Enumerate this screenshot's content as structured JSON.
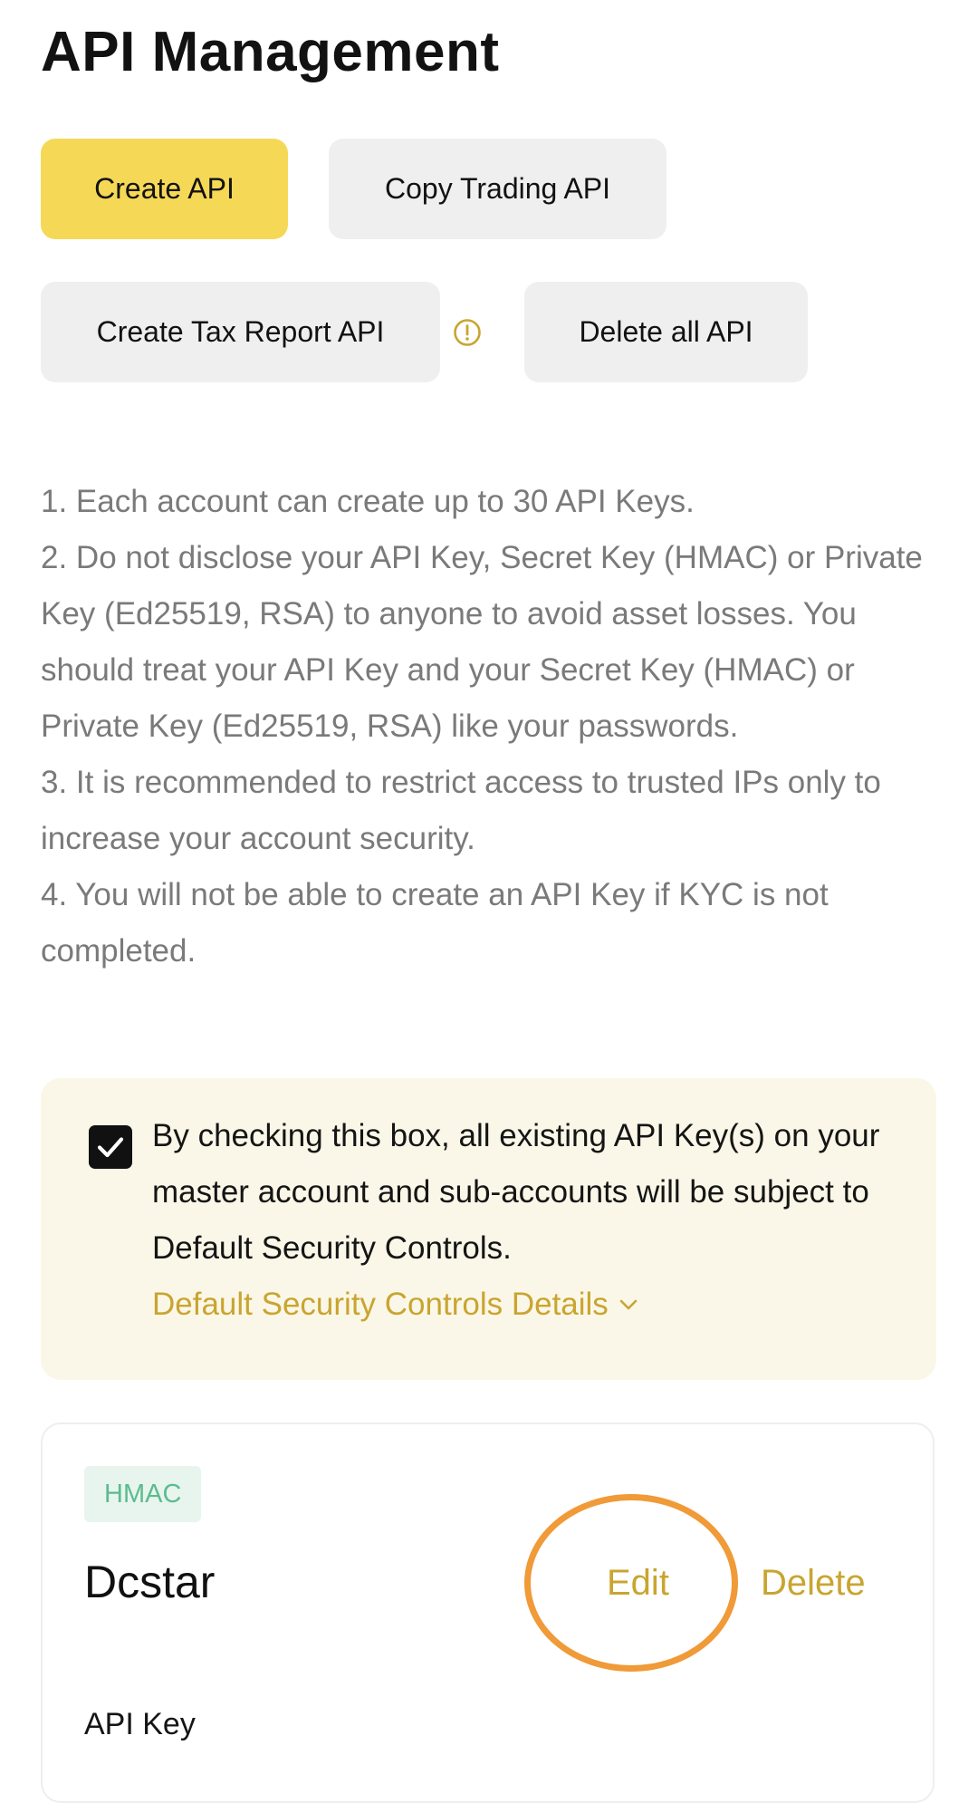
{
  "header": {
    "title": "API Management"
  },
  "actions": {
    "create_api": "Create API",
    "copy_trading_api": "Copy Trading API",
    "create_tax_report_api": "Create Tax Report API",
    "delete_all_api": "Delete all API"
  },
  "notes": [
    "1. Each account can create up to 30 API Keys.",
    "2. Do not disclose your API Key, Secret Key (HMAC) or Private Key (Ed25519, RSA) to anyone to avoid asset losses. You should treat your API Key and your Secret Key (HMAC) or Private Key (Ed25519, RSA) like your passwords.",
    "3. It is recommended to restrict access to trusted IPs only to increase your account security.",
    "4. You will not be able to create an API Key if KYC is not completed."
  ],
  "security_controls": {
    "checked": true,
    "text": "By checking this box, all existing API Key(s) on your master account and sub-accounts will be subject to Default Security Controls.",
    "details_link": "Default Security Controls Details"
  },
  "api_card": {
    "type_badge": "HMAC",
    "name": "Dcstar",
    "edit_label": "Edit",
    "delete_label": "Delete",
    "api_key_label": "API Key"
  },
  "colors": {
    "primary_button": "#f6d857",
    "accent_link": "#c9a530",
    "highlight_ring": "#f09a38",
    "badge_text": "#5dbb8e",
    "panel_background": "#fbf7e8"
  },
  "icons": {
    "info": "info-circle-icon",
    "checkbox": "checkmark-icon",
    "details_toggle": "chevron-down-icon"
  }
}
